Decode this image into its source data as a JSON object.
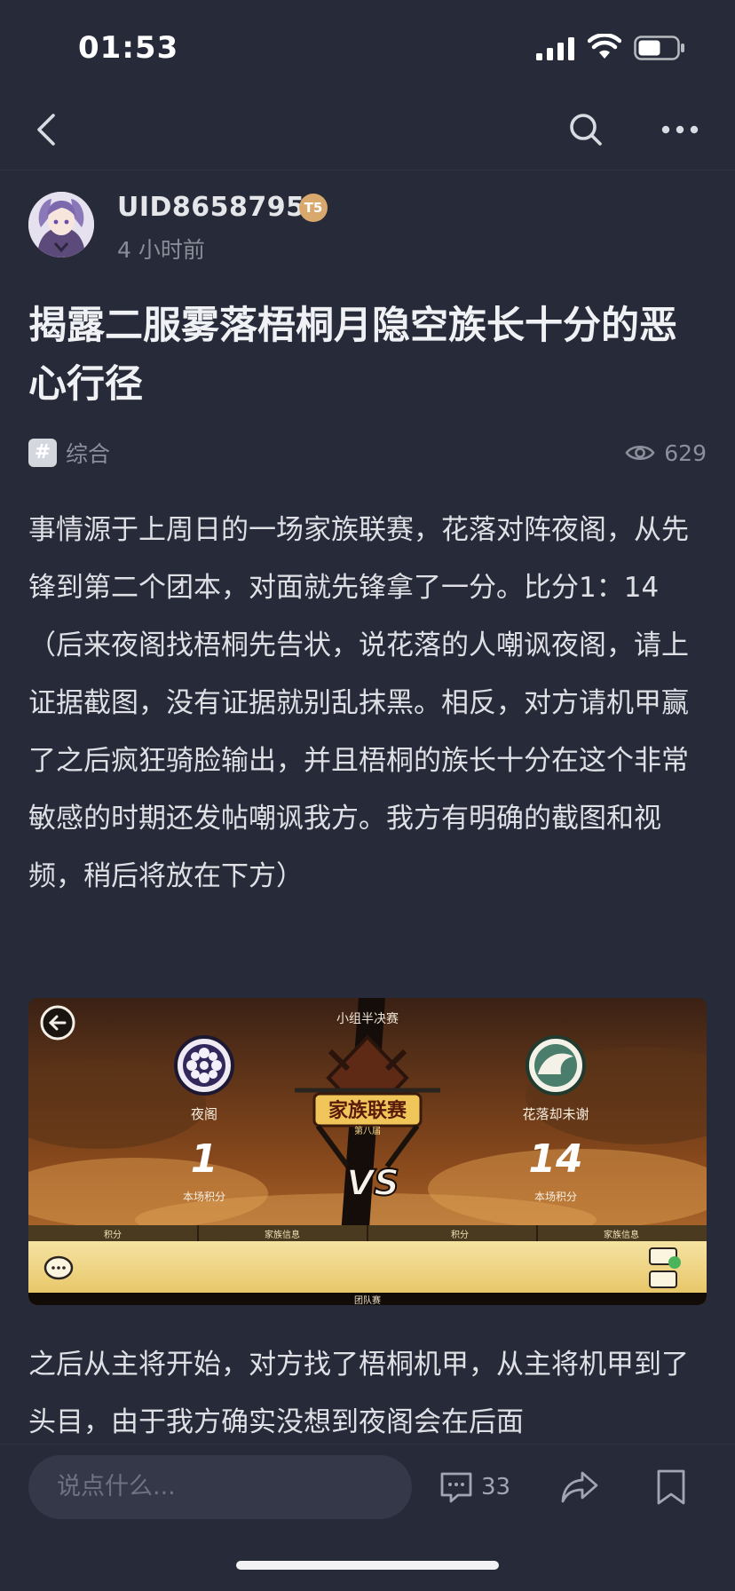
{
  "status_bar": {
    "time": "01:53"
  },
  "nav": {
    "back_icon": "chevron-left-icon",
    "search_icon": "search-icon",
    "more_icon": "more-dots-icon"
  },
  "author": {
    "name": "UID8658795",
    "level": "T5",
    "time": "4 小时前"
  },
  "post": {
    "title": "揭露二服雾落梧桐月隐空族长十分的恶心行径",
    "topic": "综合",
    "views": "629",
    "paragraph_1": "事情源于上周日的一场家族联赛，花落对阵夜阁，从先锋到第二个团本，对面就先锋拿了一分。比分1：14（后来夜阁找梧桐先告状，说花落的人嘲讽夜阁，请上证据截图，没有证据就别乱抹黑。相反，对方请机甲赢了之后疯狂骑脸输出，并且梧桐的族长十分在这个非常敏感的时期还发帖嘲讽我方。我方有明确的截图和视频，稍后将放在下方）",
    "paragraph_2": "之后从主将开始，对方找了梧桐机甲，从主将机甲到了头目，由于我方确实没想到夜阁会在后面"
  },
  "game_screenshot": {
    "header": "小组半决赛",
    "logo_top": "家族联赛",
    "logo_main": "家族联赛",
    "logo_sub": "第八届",
    "left_team": "夜阁",
    "left_score": "1",
    "left_score_label": "本场积分",
    "right_team": "花落却未谢",
    "right_score": "14",
    "right_score_label": "本场积分",
    "vs": "VS",
    "tab_1": "积分",
    "tab_2": "家族信息",
    "tab_3": "积分",
    "tab_4": "家族信息",
    "footer": "团队赛"
  },
  "bottom_bar": {
    "comment_placeholder": "说点什么...",
    "comment_count": "33"
  },
  "colors": {
    "background": "#272a38",
    "text_primary": "#f0f1f4",
    "text_secondary": "#8c8f9b",
    "input_bg": "#353848",
    "badge": "#d9a86c"
  }
}
